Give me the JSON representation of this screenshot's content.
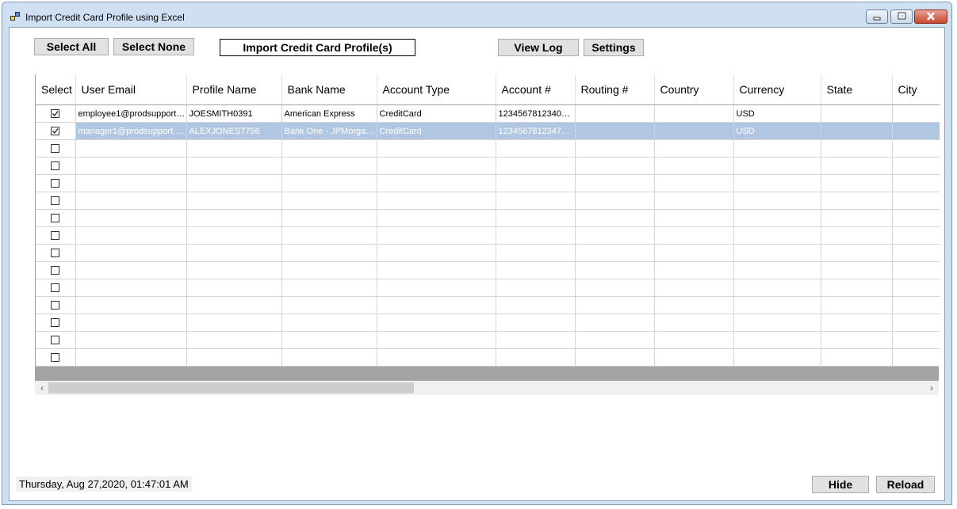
{
  "window": {
    "title": "Import Credit Card Profile using Excel"
  },
  "toolbar": {
    "select_all": "Select All",
    "select_none": "Select None",
    "import": "Import Credit Card Profile(s)",
    "view_log": "View Log",
    "settings": "Settings"
  },
  "grid": {
    "columns": [
      "Select",
      "User Email",
      "Profile Name",
      "Bank Name",
      "Account Type",
      "Account #",
      "Routing #",
      "Country",
      "Currency",
      "State",
      "City"
    ],
    "rows": [
      {
        "checked": true,
        "selected": false,
        "cells": [
          "employee1@prodsupport.…",
          "JOESMITH0391",
          "American Express",
          "CreditCard",
          "1234567812340…",
          "",
          "",
          "USD",
          "",
          ""
        ]
      },
      {
        "checked": true,
        "selected": true,
        "cells": [
          "manager1@prodsupport.c…",
          "ALEXJONES7756",
          "Bank One - JPMorga…",
          "CreditCard",
          "1234567812347…",
          "",
          "",
          "USD",
          "",
          ""
        ]
      }
    ],
    "empty_row_count": 13
  },
  "footer": {
    "timestamp": "Thursday, Aug 27,2020, 01:47:01 AM",
    "hide": "Hide",
    "reload": "Reload"
  },
  "icons": {
    "app": "app-window-icon",
    "minimize": "minimize-icon",
    "maximize": "maximize-icon",
    "close": "close-icon",
    "scroll_left": "chevron-left-icon",
    "scroll_right": "chevron-right-icon"
  },
  "colors": {
    "selected_row": "#b1c7e1",
    "window_frame": "#cfe0f3",
    "close_button": "#c4492f"
  }
}
